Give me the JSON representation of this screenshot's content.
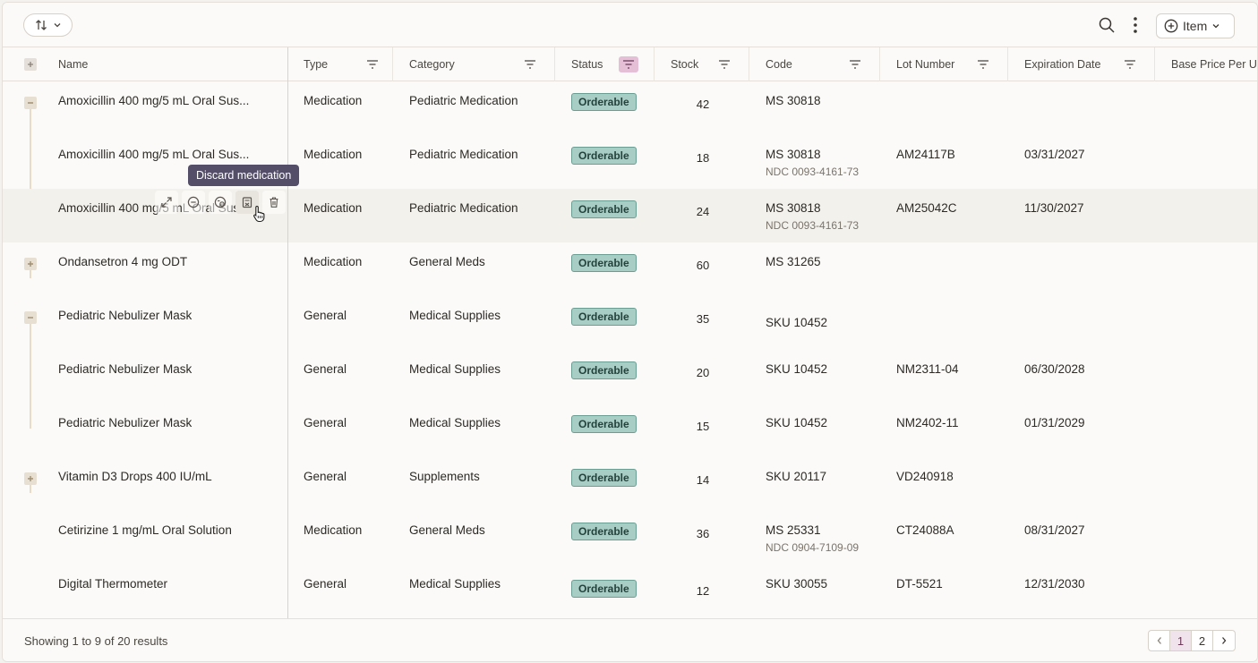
{
  "toolbar": {
    "item_button_label": "Item"
  },
  "columns": [
    {
      "label": "Name"
    },
    {
      "label": "Type"
    },
    {
      "label": "Category"
    },
    {
      "label": "Status"
    },
    {
      "label": "Stock"
    },
    {
      "label": "Code"
    },
    {
      "label": "Lot Number"
    },
    {
      "label": "Expiration Date"
    },
    {
      "label": "Base Price Per U"
    }
  ],
  "rows": [
    {
      "name": "Amoxicillin 400 mg/5 mL Oral Sus...",
      "type": "Medication",
      "category": "Pediatric Medication",
      "status": "Orderable",
      "stock": "42",
      "code": "MS 30818",
      "ndc": "",
      "lot": "",
      "exp": ""
    },
    {
      "name": "Amoxicillin 400 mg/5 mL Oral Sus...",
      "type": "Medication",
      "category": "Pediatric Medication",
      "status": "Orderable",
      "stock": "18",
      "code": "MS 30818",
      "ndc": "NDC 0093-4161-73",
      "lot": "AM24117B",
      "exp": "03/31/2027"
    },
    {
      "name": "Amoxicillin 400 mg/5 mL Oral Sus...",
      "type": "Medication",
      "category": "Pediatric Medication",
      "status": "Orderable",
      "stock": "24",
      "code": "MS 30818",
      "ndc": "NDC 0093-4161-73",
      "lot": "AM25042C",
      "exp": "11/30/2027"
    },
    {
      "name": "Ondansetron 4 mg ODT",
      "type": "Medication",
      "category": "General Meds",
      "status": "Orderable",
      "stock": "60",
      "code": "MS 31265",
      "ndc": "",
      "lot": "",
      "exp": ""
    },
    {
      "name": "Pediatric Nebulizer Mask",
      "type": "General",
      "category": "Medical Supplies",
      "status": "Orderable",
      "stock": "35",
      "code": "SKU 10452",
      "ndc": "",
      "lot": "",
      "exp": ""
    },
    {
      "name": "Pediatric Nebulizer Mask",
      "type": "General",
      "category": "Medical Supplies",
      "status": "Orderable",
      "stock": "20",
      "code": "SKU 10452",
      "ndc": "",
      "lot": "NM2311-04",
      "exp": "06/30/2028"
    },
    {
      "name": "Pediatric Nebulizer Mask",
      "type": "General",
      "category": "Medical Supplies",
      "status": "Orderable",
      "stock": "15",
      "code": "SKU 10452",
      "ndc": "",
      "lot": "NM2402-11",
      "exp": "01/31/2029"
    },
    {
      "name": "Vitamin D3 Drops 400 IU/mL",
      "type": "General",
      "category": "Supplements",
      "status": "Orderable",
      "stock": "14",
      "code": "SKU 20117",
      "ndc": "",
      "lot": "VD240918",
      "exp": ""
    },
    {
      "name": "Cetirizine 1 mg/mL Oral Solution",
      "type": "Medication",
      "category": "General Meds",
      "status": "Orderable",
      "stock": "36",
      "code": "MS 25331",
      "ndc": "NDC 0904-7109-09",
      "lot": "CT24088A",
      "exp": "08/31/2027"
    },
    {
      "name": "Digital Thermometer",
      "type": "General",
      "category": "Medical Supplies",
      "status": "Orderable",
      "stock": "12",
      "code": "SKU 30055",
      "ndc": "",
      "lot": "DT-5521",
      "exp": "12/31/2030"
    }
  ],
  "tooltip": "Discard medication",
  "footer": {
    "showing": "Showing 1 to 9 of 20 results",
    "pages": [
      "1",
      "2"
    ]
  }
}
